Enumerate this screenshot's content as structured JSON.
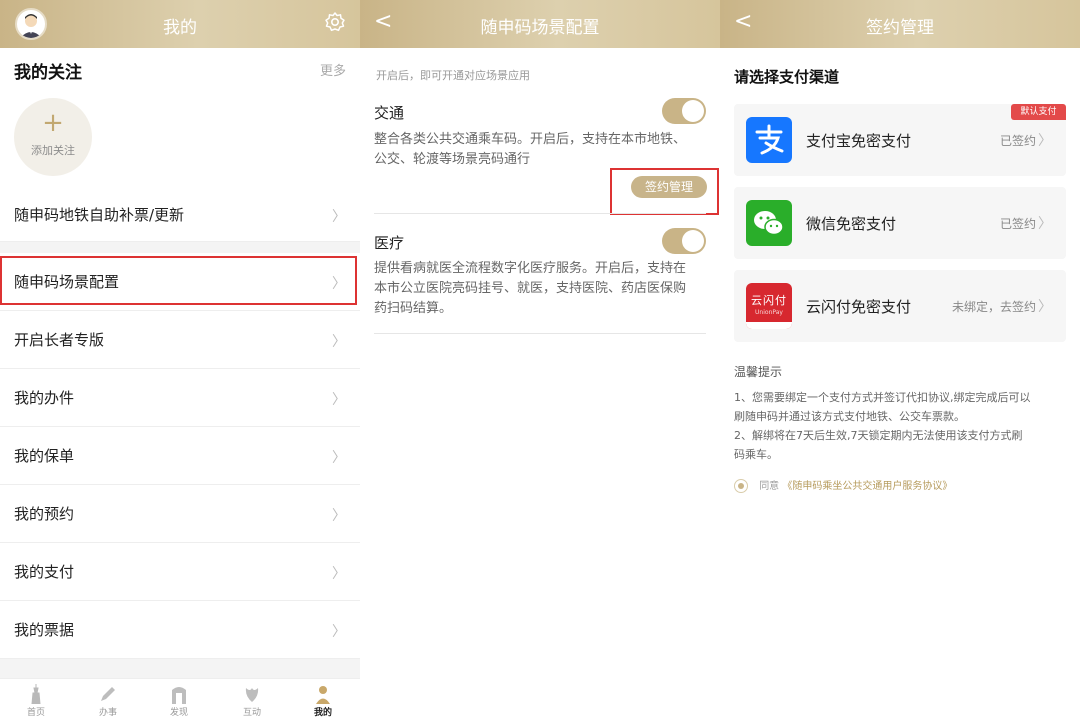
{
  "panel1": {
    "title": "我的",
    "follow_title": "我的关注",
    "more": "更多",
    "add_follow": "添加关注",
    "menu": [
      "随申码地铁自助补票/更新",
      "随申码场景配置",
      "开启长者专版",
      "我的办件",
      "我的保单",
      "我的预约",
      "我的支付",
      "我的票据"
    ],
    "tabs": [
      "首页",
      "办事",
      "发现",
      "互动",
      "我的"
    ]
  },
  "panel2": {
    "title": "随申码场景配置",
    "hint": "开启后，即可开通对应场景应用",
    "traffic_title": "交通",
    "traffic_desc_1": "整合各类公共交通乘车码。开启后，支持在本市地铁、",
    "traffic_desc_2": "公交、轮渡等场景亮码通行",
    "sign_manage": "签约管理",
    "medical_title": "医疗",
    "medical_desc_1": "提供看病就医全流程数字化医疗服务。开启后，支持在",
    "medical_desc_2": "本市公立医院亮码挂号、就医，支持医院、药店医保购",
    "medical_desc_3": "药扫码结算。"
  },
  "panel3": {
    "title": "签约管理",
    "choose": "请选择支付渠道",
    "default_badge": "默认支付",
    "channels": [
      {
        "name": "支付宝免密支付",
        "status": "已签约",
        "icon": "alipay-icon",
        "color": "#1677ff"
      },
      {
        "name": "微信免密支付",
        "status": "已签约",
        "icon": "wechat-icon",
        "color": "#2aae2a"
      },
      {
        "name": "云闪付免密支付",
        "status": "未绑定，去签约",
        "icon": "unionpay-icon",
        "color": "#d7282f"
      }
    ],
    "unionpay_logo_text": "云闪付",
    "unionpay_logo_sub": "UnionPay",
    "tips_title": "温馨提示",
    "tip1_line1": "1、您需要绑定一个支付方式并签订代扣协议,绑定完成后可以",
    "tip1_line2": "刷随申码并通过该方式支付地铁、公交车票款。",
    "tip2_line1": "2、解绑将在7天后生效,7天锁定期内无法使用该支付方式刷",
    "tip2_line2": "码乘车。",
    "agree_prefix": "同意",
    "agree_link": "《随申码乘坐公共交通用户服务协议》"
  },
  "colors": {
    "gold": "#c9b487",
    "highlight": "#d33333"
  }
}
